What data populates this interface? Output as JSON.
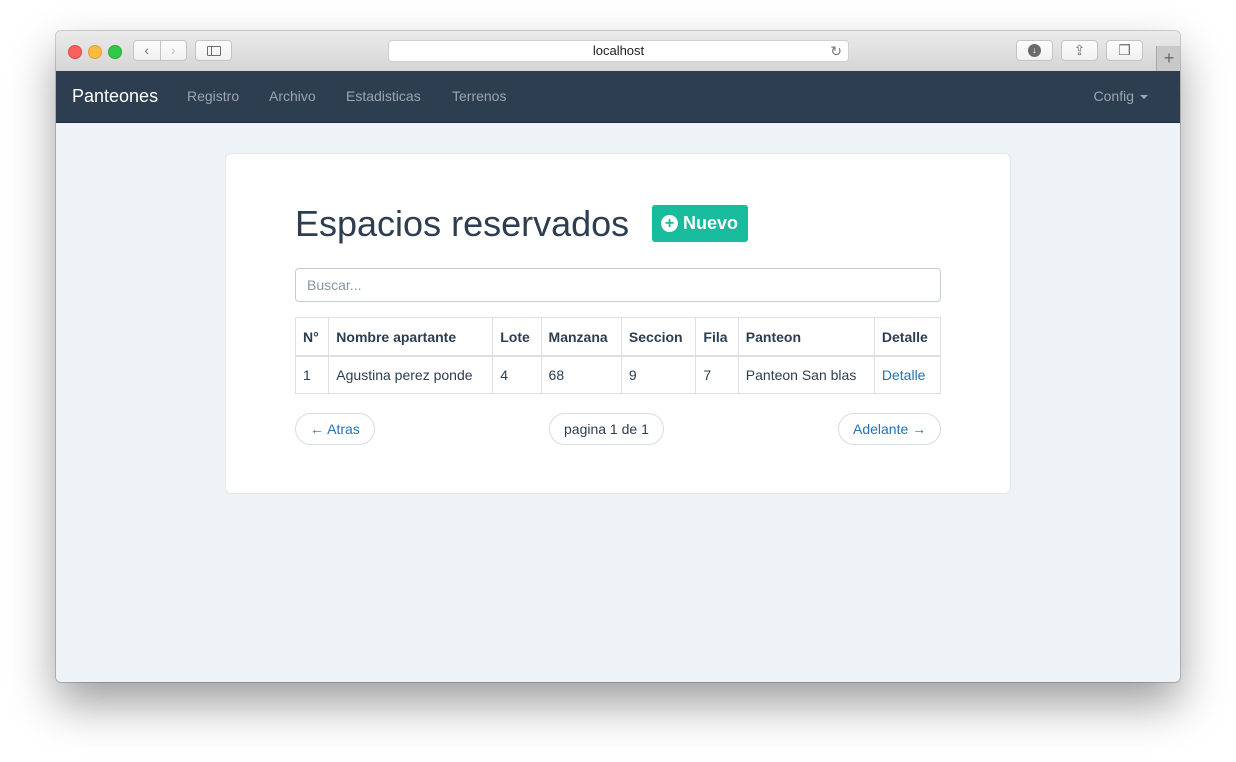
{
  "browser": {
    "url": "localhost"
  },
  "navbar": {
    "brand": "Panteones",
    "links": [
      "Registro",
      "Archivo",
      "Estadisticas",
      "Terrenos"
    ],
    "config": "Config"
  },
  "page": {
    "title": "Espacios reservados",
    "new_button": "Nuevo",
    "search_placeholder": "Buscar..."
  },
  "table": {
    "headers": [
      "N°",
      "Nombre apartante",
      "Lote",
      "Manzana",
      "Seccion",
      "Fila",
      "Panteon",
      "Detalle"
    ],
    "rows": [
      [
        "1",
        "Agustina perez ponde",
        "4",
        "68",
        "9",
        "7",
        "Panteon San blas",
        "Detalle"
      ]
    ]
  },
  "pager": {
    "prev": "← Atras",
    "info": "pagina 1 de 1",
    "next": "Adelante →"
  },
  "colors": {
    "navbar": "#2c3e50",
    "accent": "#18bc9c",
    "link": "#2472b3",
    "background": "#eef3f7"
  }
}
